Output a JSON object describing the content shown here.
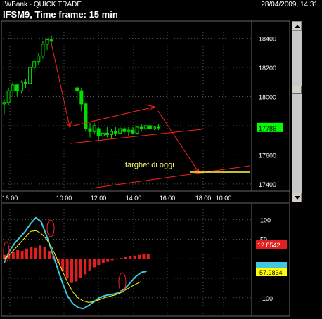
{
  "header": {
    "app_title": "IWBank - QUICK TRADE",
    "datetime": "28/04/2009, 14:31",
    "chart_title": "IFSM9, Time frame: 15 min"
  },
  "price_panel": {
    "y_ticks": [
      "18400",
      "18200",
      "18000",
      "17800",
      "17600",
      "17400"
    ],
    "y_tick_values": [
      18400,
      18200,
      18000,
      17800,
      17600,
      17400
    ],
    "current_price_label": "17786",
    "current_price_color": "#00ff00",
    "annotation_text": "targhet di oggi",
    "annotation_color": "#ffff66",
    "trend_color": "#ff2020"
  },
  "x_axis": {
    "ticks": [
      "16:00",
      "10:00",
      "12:00",
      "14:00",
      "16:00",
      "18:00",
      "10:00"
    ]
  },
  "indicator_panel": {
    "y_ticks": [
      "100",
      "50",
      "0",
      "-50",
      "-100"
    ],
    "y_tick_values": [
      100,
      50,
      0,
      -50,
      -100
    ],
    "histogram_label": "12.8542",
    "histogram_label_color": "#e02020",
    "signal_label": "-57.9834",
    "signal_label_color": "#ffff00",
    "macd_label": "",
    "macd_label_color": "#40c8e0"
  },
  "chart_data": [
    {
      "type": "candlestick",
      "title": "IFSM9, Time frame: 15 min",
      "ylim": [
        17380,
        18480
      ],
      "candles": [
        [
          17950,
          17980,
          17880,
          17960
        ],
        [
          17960,
          18060,
          17940,
          18040
        ],
        [
          18040,
          18100,
          18000,
          18080
        ],
        [
          18080,
          18090,
          18000,
          18040
        ],
        [
          18040,
          18110,
          18020,
          18100
        ],
        [
          18100,
          18120,
          18060,
          18090
        ],
        [
          18090,
          18220,
          18080,
          18200
        ],
        [
          18200,
          18260,
          18160,
          18240
        ],
        [
          18240,
          18300,
          18220,
          18280
        ],
        [
          18280,
          18380,
          18260,
          18360
        ],
        [
          18360,
          18400,
          18320,
          18390
        ],
        [
          18390,
          18420,
          18360,
          18380
        ],
        null,
        null,
        null,
        null,
        null,
        [
          18060,
          18080,
          17980,
          18040
        ],
        [
          18040,
          18060,
          17900,
          17950
        ],
        [
          17950,
          17960,
          17760,
          17780
        ],
        [
          17780,
          17820,
          17720,
          17760
        ],
        [
          17760,
          17820,
          17740,
          17800
        ],
        [
          17780,
          17790,
          17700,
          17730
        ],
        [
          17730,
          17770,
          17700,
          17750
        ],
        [
          17750,
          17790,
          17720,
          17740
        ],
        [
          17740,
          17780,
          17710,
          17760
        ],
        [
          17760,
          17790,
          17730,
          17750
        ],
        [
          17750,
          17800,
          17740,
          17780
        ],
        [
          17780,
          17800,
          17740,
          17760
        ],
        [
          17760,
          17790,
          17730,
          17770
        ],
        [
          17770,
          17790,
          17740,
          17750
        ],
        [
          17750,
          17800,
          17740,
          17790
        ],
        [
          17790,
          17810,
          17760,
          17780
        ],
        [
          17780,
          17820,
          17760,
          17800
        ],
        [
          17800,
          17810,
          17760,
          17780
        ],
        [
          17780,
          17800,
          17770,
          17790
        ],
        [
          17790,
          17810,
          17770,
          17786
        ]
      ],
      "current_price": 17786,
      "target_price": 17480
    },
    {
      "type": "macd",
      "ylim": [
        -140,
        130
      ],
      "histogram": [
        10,
        14,
        18,
        22,
        20,
        26,
        30,
        28,
        34,
        30,
        20,
        8,
        -10,
        -30,
        -50,
        -62,
        -58,
        -50,
        -40,
        -30,
        -22,
        -16,
        -12,
        -8,
        -4,
        0,
        2,
        4,
        6,
        8,
        10,
        12,
        13
      ],
      "macd_line": [
        -10,
        20,
        40,
        55,
        70,
        90,
        105,
        95,
        60,
        20,
        -20,
        -60,
        -95,
        -115,
        -125,
        -128,
        -120,
        -110,
        -100,
        -95,
        -92,
        -90,
        -85,
        -75,
        -60,
        -45,
        -35,
        -32
      ],
      "signal_line": [
        0,
        10,
        25,
        40,
        55,
        70,
        72,
        65,
        50,
        30,
        0,
        -30,
        -60,
        -85,
        -100,
        -108,
        -112,
        -110,
        -105,
        -100,
        -96,
        -93,
        -88,
        -80,
        -72,
        -65,
        -58
      ]
    }
  ]
}
